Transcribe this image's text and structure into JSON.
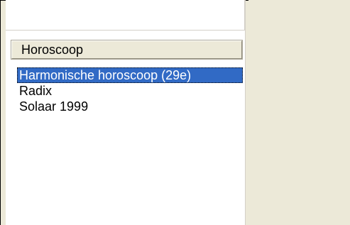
{
  "list_header": {
    "label": "Horoscoop"
  },
  "horoscope_list": {
    "items": [
      {
        "label": "Harmonische horoscoop (29e)",
        "selected": true
      },
      {
        "label": "Radix",
        "selected": false
      },
      {
        "label": "Solaar 1999",
        "selected": false
      }
    ]
  },
  "colors": {
    "selection": "#316ac5",
    "panel_background": "#ece9d8",
    "list_background": "#ffffff"
  }
}
